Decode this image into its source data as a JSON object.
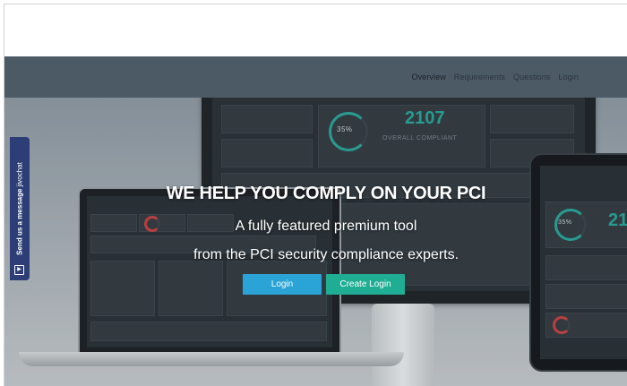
{
  "nav": {
    "items": [
      {
        "label": "Overview",
        "active": true
      },
      {
        "label": "Requirements",
        "active": false
      },
      {
        "label": "Questions",
        "active": false
      },
      {
        "label": "Login",
        "active": false
      }
    ]
  },
  "hero": {
    "title": "WE HELP YOU COMPLY ON YOUR PCI",
    "subtitle_line1": "A fully featured premium tool",
    "subtitle_line2": "from the PCI security compliance experts.",
    "login_button": "Login",
    "create_login_button": "Create Login"
  },
  "chat_widget": {
    "label": "Send us a message",
    "brand": "jivochat",
    "icon": "chat-bubble-icon"
  },
  "mockup": {
    "monitor_number": "2107",
    "monitor_caption": "OVERALL COMPLIANT",
    "monitor_percent": "35%",
    "tablet_percent": "35%",
    "tablet_number": "21"
  },
  "colors": {
    "navbar": "#4c5a66",
    "login_button": "#2aa3d6",
    "create_button": "#1fae94",
    "chat_tab": "#2c3e75",
    "accent_ring": "#2aa89b"
  }
}
